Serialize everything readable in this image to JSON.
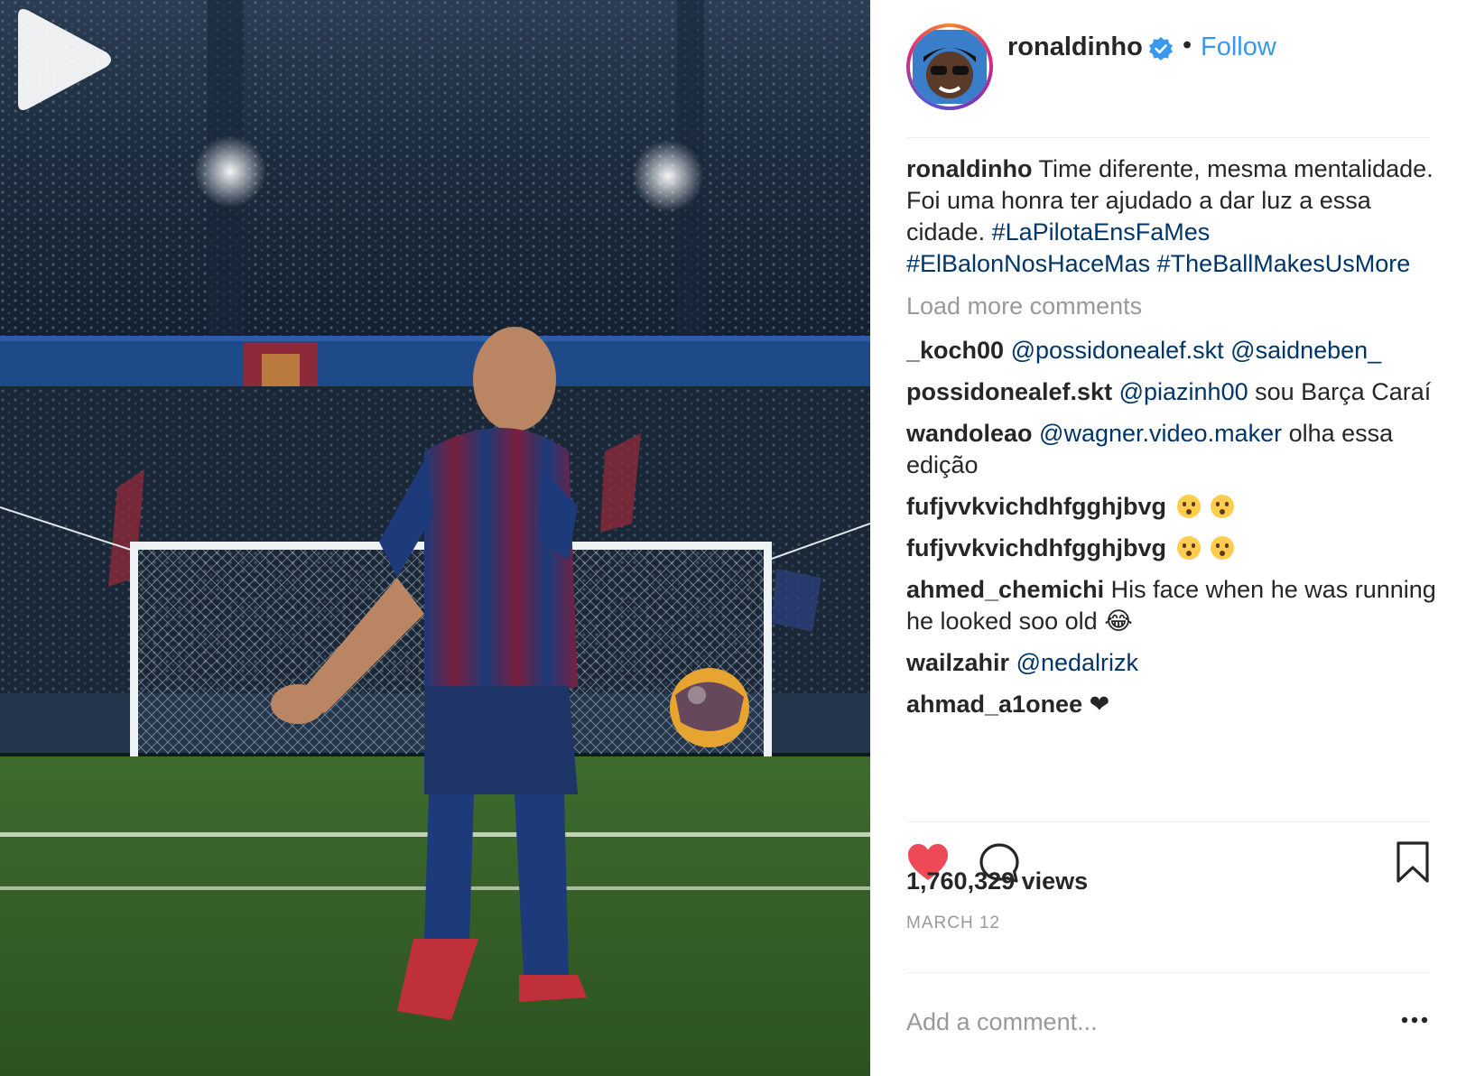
{
  "post": {
    "author": "ronaldinho",
    "follow_label": "Follow",
    "separator": "•"
  },
  "caption": {
    "username": "ronaldinho",
    "text": "Time diferente, mesma mentalidade. Foi uma honra ter ajudado a dar luz a essa cidade.",
    "hashtags": [
      "#LaPilotaEnsFaMes",
      "#ElBalonNosHaceMas",
      "#TheBallMakesUsMore"
    ]
  },
  "load_more": "Load more comments",
  "comments": [
    {
      "user": "_koch00",
      "mentions": [
        "@possidonealef.skt",
        "@saidneben_"
      ],
      "text": ""
    },
    {
      "user": "possidonealef.skt",
      "mentions": [
        "@piazinh00"
      ],
      "text": "sou Barça Caraí"
    },
    {
      "user": "wandoleao",
      "mentions": [
        "@wagner.video.maker"
      ],
      "text": "olha essa edição"
    },
    {
      "user": "fufjvvkvichdhfgghjbvg",
      "emoji": "hushed-face-emoji x2"
    },
    {
      "user": "fufjvvkvichdhfgghjbvg",
      "emoji": "hushed-face-emoji x2"
    },
    {
      "user": "ahmed_chemichi",
      "text": "His face when he was running he looked soo old",
      "emoji": "😂"
    },
    {
      "user": "wailzahir",
      "mentions": [
        "@nedalrizk"
      ],
      "text": ""
    },
    {
      "user": "ahmad_a1onee",
      "text": "❤"
    }
  ],
  "stats": {
    "views": "1,760,329 views",
    "date": "MARCH 12"
  },
  "add_comment": {
    "placeholder": "Add a comment..."
  },
  "icons": [
    "play-icon",
    "verified-badge-icon",
    "heart-icon",
    "comment-icon",
    "bookmark-icon",
    "more-options-icon"
  ],
  "colors": {
    "link": "#003569",
    "follow": "#3897f0",
    "like": "#ed4956",
    "muted": "#999999"
  }
}
